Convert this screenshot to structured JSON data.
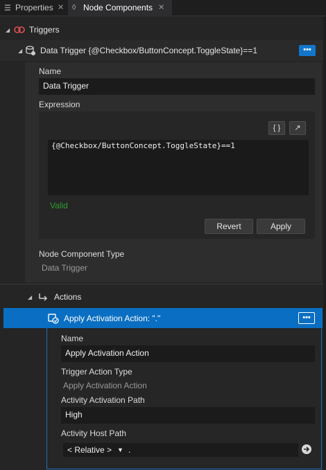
{
  "tabs": [
    {
      "label": "Properties",
      "icon": "properties-icon"
    },
    {
      "label": "Node Components",
      "icon": "node-components-icon"
    }
  ],
  "triggers": {
    "label": "Triggers"
  },
  "data_trigger": {
    "title": "Data Trigger {@Checkbox/ButtonConcept.ToggleState}==1",
    "name_label": "Name",
    "name_value": "Data Trigger",
    "expression_label": "Expression",
    "expression_value": "{@Checkbox/ButtonConcept.ToggleState}==1",
    "braces_btn": "{ }",
    "expand_btn": "↗",
    "status": "Valid",
    "revert": "Revert",
    "apply": "Apply",
    "type_label": "Node Component Type",
    "type_value": "Data Trigger"
  },
  "actions": {
    "label": "Actions"
  },
  "apply_action": {
    "title": "Apply Activation Action: \".\"",
    "name_label": "Name",
    "name_value": "Apply Activation Action",
    "type_label": "Trigger Action Type",
    "type_value": "Apply Activation Action",
    "path_label": "Activity Activation Path",
    "path_value": "High",
    "host_label": "Activity Host Path",
    "host_select": "< Relative >",
    "host_value": "."
  },
  "menu_dots": "•••",
  "colors": {
    "accent": "#1177cc",
    "selected_row": "#0a6fc2",
    "valid": "#2e9e2e"
  }
}
